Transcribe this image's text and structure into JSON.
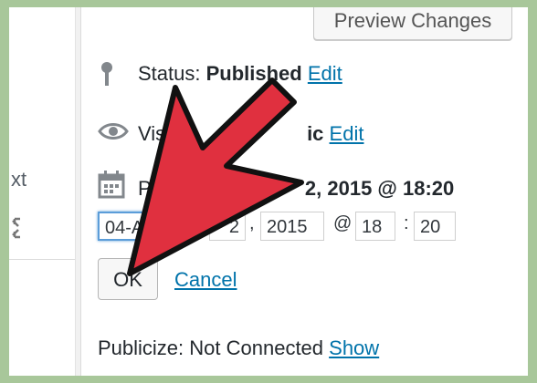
{
  "sidebar": {
    "text_fragment": "xt"
  },
  "publish_box": {
    "preview_button": "Preview Changes",
    "status_label": "Status: ",
    "status_value": "Published",
    "status_edit": "Edit",
    "visibility_label": "Visi",
    "visibility_value": "ic",
    "visibility_edit": "Edit",
    "publish_label": "Pu",
    "publish_value": "2, 2015 @ 18:20",
    "date_fields": {
      "month": "04-Au",
      "day": "2",
      "comma": ",",
      "year": "2015",
      "at": "@",
      "hour": "18",
      "colon": ":",
      "minute": "20"
    },
    "ok_button": "OK",
    "cancel_link": "Cancel",
    "publicize_label": "Publicize: Not Connected ",
    "publicize_link": "Show"
  },
  "colors": {
    "arrow_fill": "#e0303f",
    "link": "#0073aa",
    "background": "#a8c79a"
  },
  "icons": [
    "pin-icon",
    "eye-icon",
    "calendar-icon",
    "expand-icon",
    "red-arrow-pointer"
  ]
}
